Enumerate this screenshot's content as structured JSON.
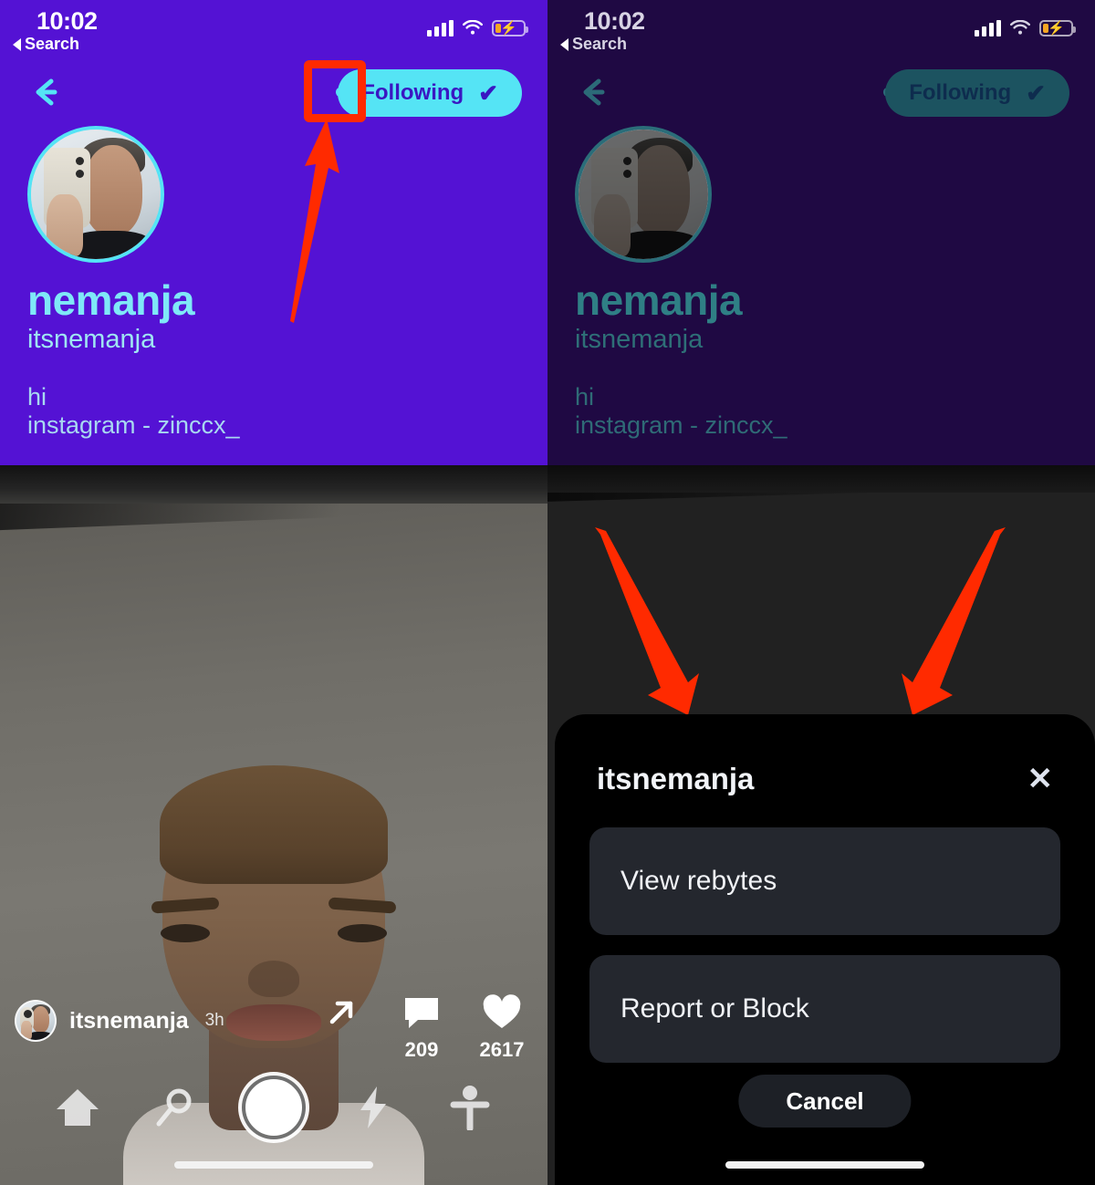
{
  "meta": {
    "accent_cyan": "#55E4F5",
    "brand_purple": "#5412D4",
    "dim_purple": "#1F0943",
    "annotation_red": "#FF2A00",
    "sheet_black": "#000000",
    "sheet_item_grey": "#24272E"
  },
  "status_bar": {
    "time": "10:02",
    "back_label": "Search",
    "signal_icon": "cellular-signal-icon",
    "wifi_icon": "wifi-icon",
    "battery_icon": "battery-charging-icon"
  },
  "profile": {
    "back_icon": "back-arrow-icon",
    "more_icon": "more-options-icon",
    "follow_label": "Following",
    "follow_check": "✔",
    "display_name": "nemanja",
    "handle": "itsnemanja",
    "bio_line_1": "hi",
    "bio_line_2": "instagram - zinccx_",
    "avatar_icon": "profile-avatar"
  },
  "video": {
    "author_handle": "itsnemanja",
    "timestamp": "3h",
    "share_icon": "share-arrow-icon",
    "comment_icon": "comment-bubble-icon",
    "comment_count": "209",
    "like_icon": "heart-icon",
    "like_count": "2617",
    "tabs": [
      {
        "icon": "home-icon",
        "name": "home"
      },
      {
        "icon": "search-icon",
        "name": "search"
      },
      {
        "icon": "record-icon",
        "name": "record"
      },
      {
        "icon": "lightning-icon",
        "name": "activity"
      },
      {
        "icon": "person-icon",
        "name": "profile"
      }
    ]
  },
  "action_sheet": {
    "title": "itsnemanja",
    "close_icon": "close-x-icon",
    "items": [
      {
        "label": "View rebytes"
      },
      {
        "label": "Report or Block"
      }
    ],
    "cancel_label": "Cancel"
  },
  "annotations": {
    "highlight_box": "more-options-highlight",
    "arrow_up": "pointer-arrow-up",
    "arrow_down_left": "pointer-arrow-down-left",
    "arrow_down_right": "pointer-arrow-down-right"
  }
}
